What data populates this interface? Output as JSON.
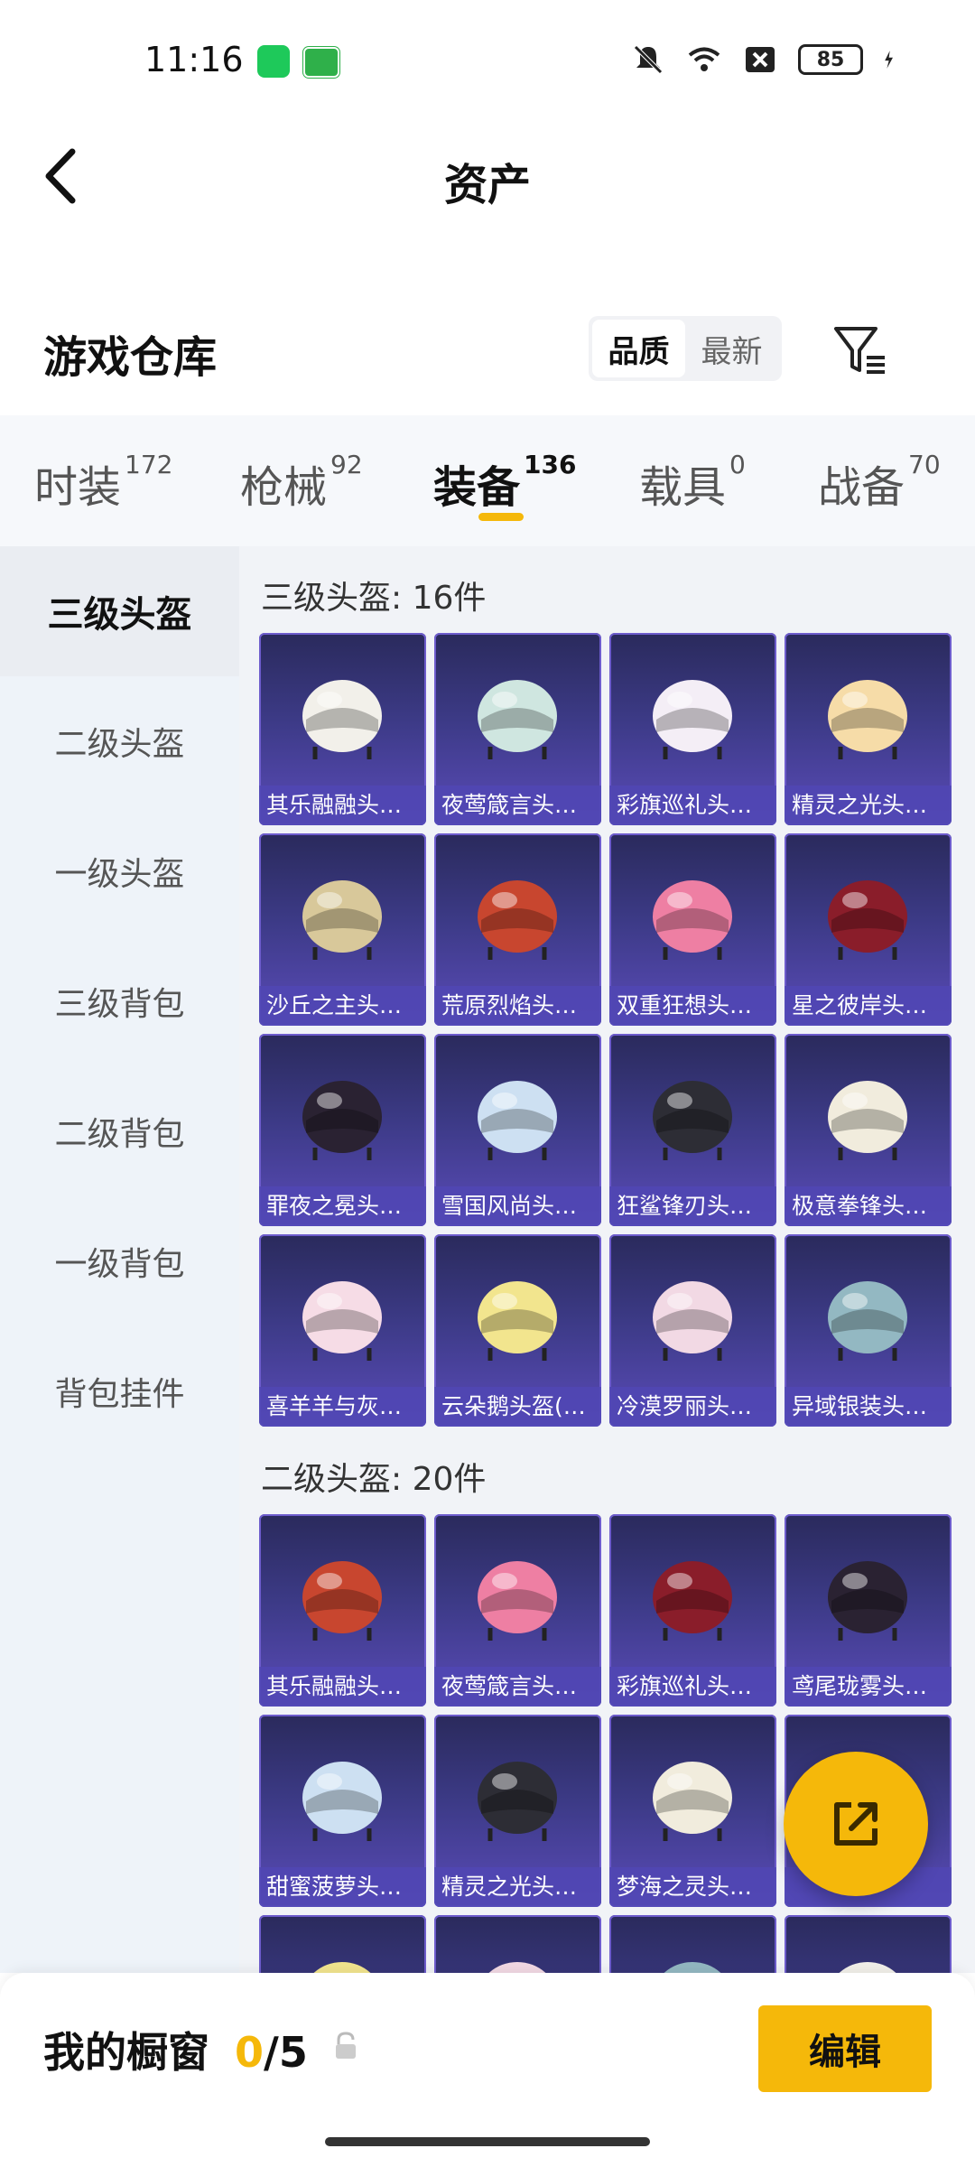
{
  "status_bar": {
    "time": "11:16",
    "battery": "85"
  },
  "header": {
    "title": "资产"
  },
  "warehouse": {
    "title": "游戏仓库",
    "sort_options": [
      "品质",
      "最新"
    ],
    "sort_active": "品质"
  },
  "tabs": [
    {
      "label": "时装",
      "count": "172"
    },
    {
      "label": "枪械",
      "count": "92"
    },
    {
      "label": "装备",
      "count": "136",
      "active": true
    },
    {
      "label": "载具",
      "count": "0"
    },
    {
      "label": "战备",
      "count": "70"
    }
  ],
  "sidebar": [
    {
      "label": "三级头盔",
      "active": true
    },
    {
      "label": "二级头盔"
    },
    {
      "label": "一级头盔"
    },
    {
      "label": "三级背包"
    },
    {
      "label": "二级背包"
    },
    {
      "label": "一级背包"
    },
    {
      "label": "背包挂件"
    }
  ],
  "sections": [
    {
      "title": "三级头盔: 16件",
      "items": [
        "其乐融融头盔...",
        "夜莺箴言头盔...",
        "彩旗巡礼头盔...",
        "精灵之光头盔...",
        "沙丘之主头盔...",
        "荒原烈焰头盔...",
        "双重狂想头盔...",
        "星之彼岸头盔...",
        "罪夜之冕头盔...",
        "雪国风尚头盔...",
        "狂鲨锋刃头盔...",
        "极意拳锋头盔...",
        "喜羊羊与灰太...",
        "云朵鹅头盔(3...",
        "冷漠罗丽头盔...",
        "异域银装头盔..."
      ]
    },
    {
      "title": "二级头盔: 20件",
      "items": [
        "其乐融融头盔...",
        "夜莺箴言头盔...",
        "彩旗巡礼头盔...",
        "鸢尾珑雾头盔...",
        "甜蜜菠萝头盔...",
        "精灵之光头盔...",
        "梦海之灵头盔...",
        "",
        "",
        "",
        "",
        ""
      ]
    }
  ],
  "bottom": {
    "showcase_label": "我的橱窗",
    "used": "0",
    "total": "/5",
    "edit_label": "编辑"
  },
  "colors": {
    "accent": "#f5b80a",
    "card_top": "#2a2a5c",
    "card_bottom": "#5a4bb8"
  }
}
